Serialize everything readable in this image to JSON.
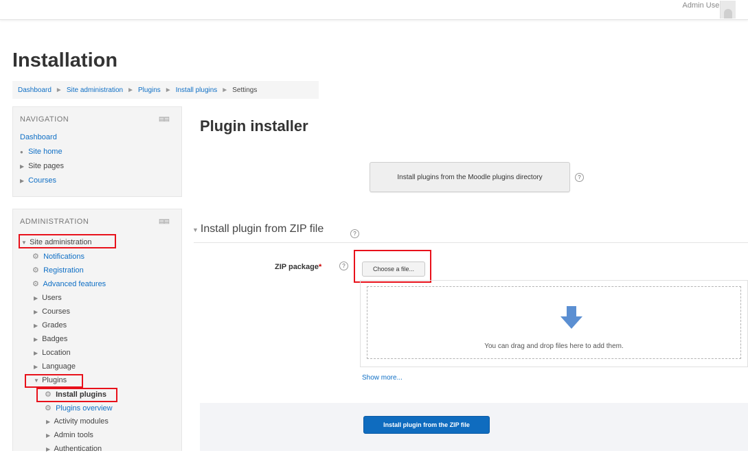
{
  "topbar": {
    "user_name": "Admin User"
  },
  "page_title": "Installation",
  "breadcrumb": {
    "items": [
      "Dashboard",
      "Site administration",
      "Plugins",
      "Install plugins",
      "Settings"
    ],
    "separator": "►"
  },
  "navigation_block": {
    "title": "NAVIGATION",
    "items": [
      "Dashboard",
      "Site home",
      "Site pages",
      "Courses"
    ]
  },
  "administration_block": {
    "title": "ADMINISTRATION",
    "items": [
      "Site administration",
      "Notifications",
      "Registration",
      "Advanced features",
      "Users",
      "Courses",
      "Grades",
      "Badges",
      "Location",
      "Language",
      "Plugins",
      "Install plugins",
      "Plugins overview",
      "Activity modules",
      "Admin tools",
      "Authentication"
    ]
  },
  "main": {
    "title": "Plugin installer",
    "directory_button": "Install plugins from the Moodle plugins directory",
    "zip_section": {
      "legend": "Install plugin from ZIP file",
      "field_label": "ZIP package",
      "required_mark": "*",
      "choose_button": "Choose a file...",
      "drop_text": "You can drag and drop files here to add them.",
      "show_more": "Show more..."
    },
    "install_button": "Install plugin from the ZIP file"
  },
  "colors": {
    "link": "#0f6fc5",
    "primary_button": "#0f6cbf",
    "highlight_box": "#e8101a",
    "drop_arrow": "#5b8fd2"
  },
  "icons": [
    "help-icon",
    "gear-icon",
    "expand-arrow-icon",
    "collapse-arrow-icon",
    "down-arrow-icon",
    "block-controls-icon"
  ]
}
